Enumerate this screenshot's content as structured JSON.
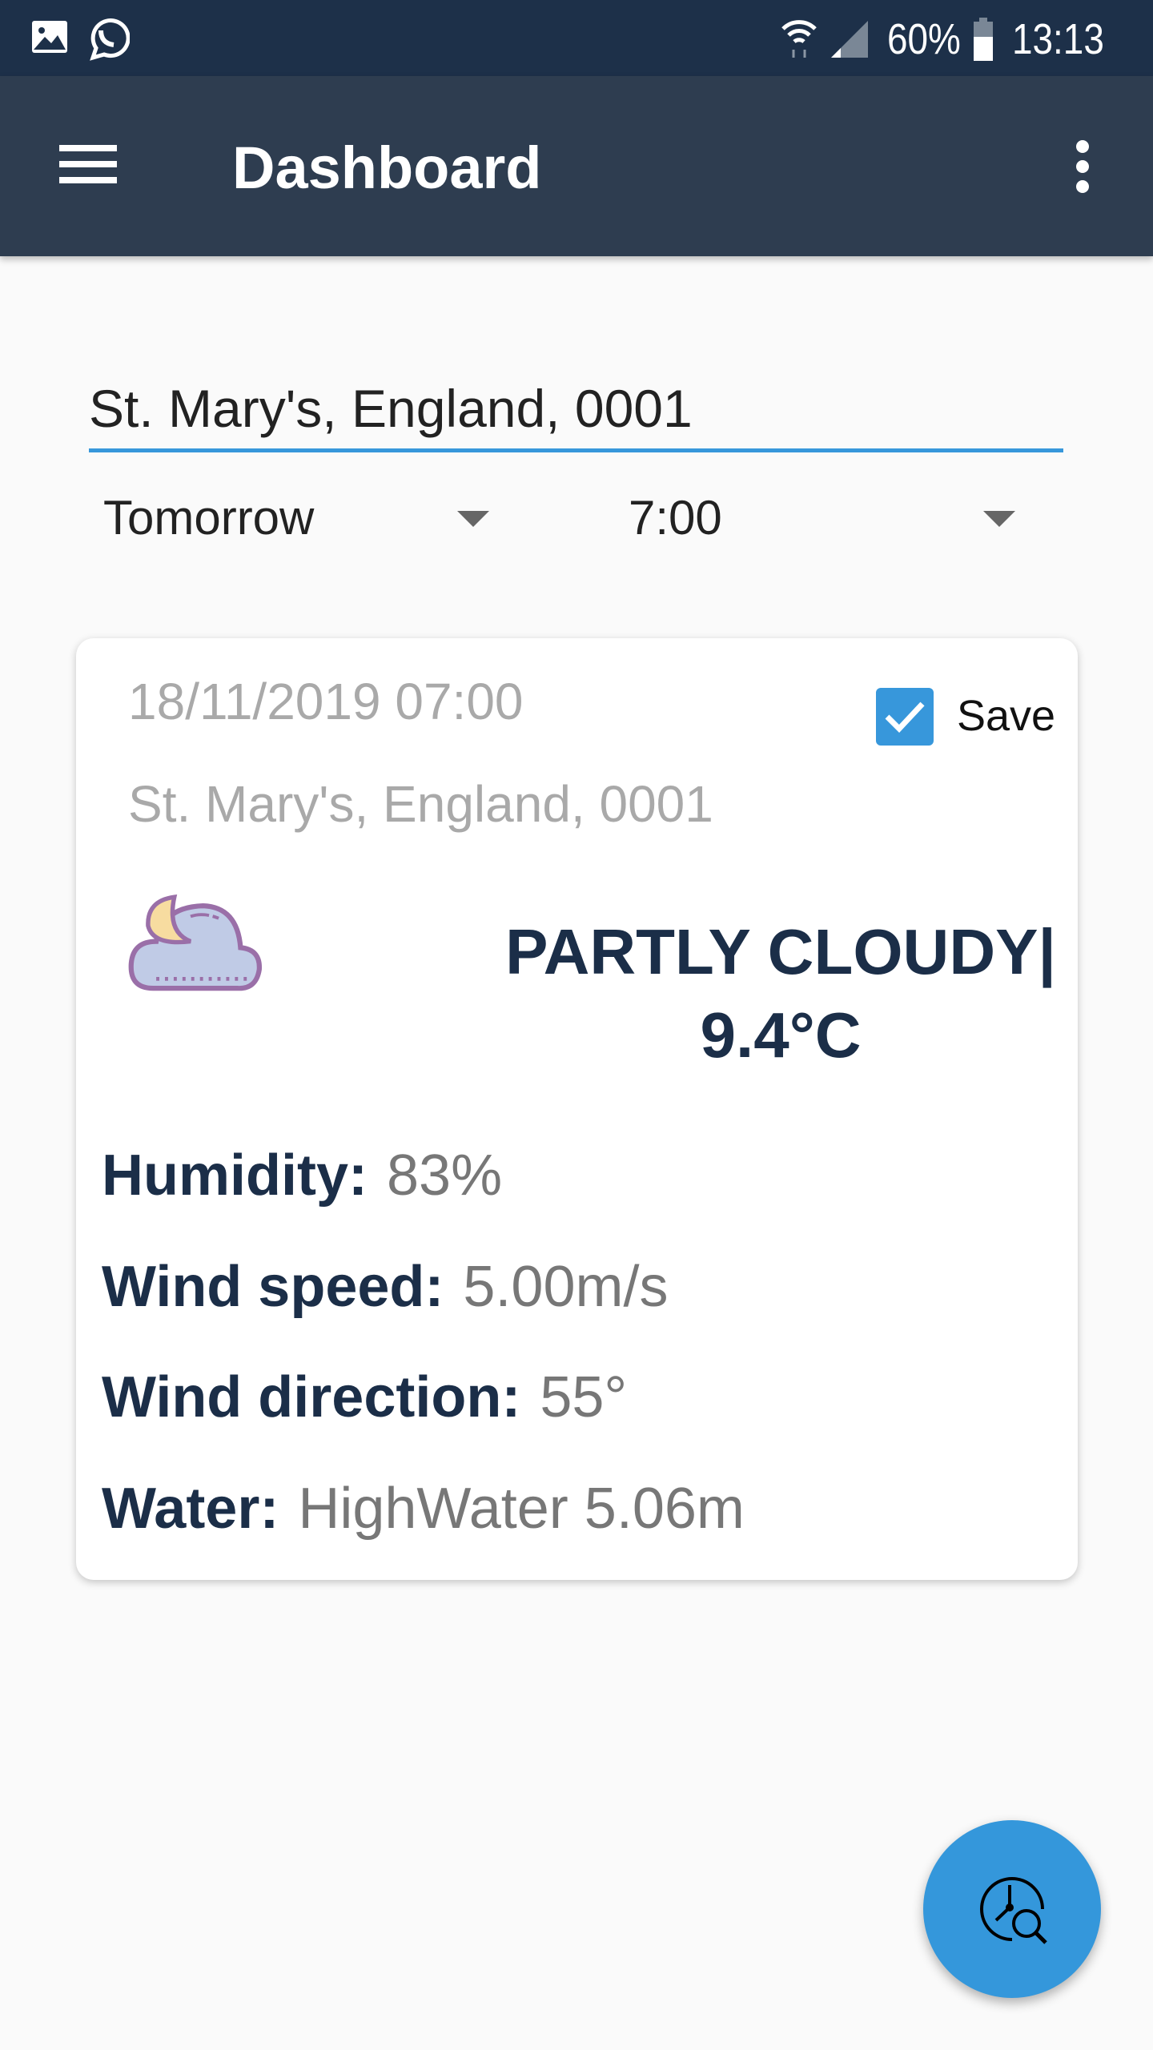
{
  "status_bar": {
    "battery": "60%",
    "time": "13:13",
    "icons": [
      "gallery-icon",
      "whatsapp-icon",
      "wifi-icon",
      "signal-icon",
      "battery-icon"
    ]
  },
  "app_bar": {
    "title": "Dashboard",
    "menu_icon": "hamburger-icon",
    "overflow_icon": "more-vert-icon"
  },
  "search": {
    "location_value": "St. Mary's, England, 0001"
  },
  "filters": {
    "day": "Tomorrow",
    "time": "7:00"
  },
  "card": {
    "datetime": "18/11/2019 07:00",
    "location": "St. Mary's, England, 0001",
    "save_label": "Save",
    "save_checked": true,
    "weather_icon": "partly-cloudy-night-icon",
    "condition": "PARTLY CLOUDY|",
    "temperature": "9.4°C",
    "details": [
      {
        "label": "Humidity:",
        "value": "83%"
      },
      {
        "label": "Wind speed:",
        "value": "5.00m/s"
      },
      {
        "label": "Wind direction:",
        "value": "55°"
      },
      {
        "label": "Water:",
        "value": "HighWater 5.06m"
      }
    ]
  },
  "fab": {
    "icon": "clock-search-icon"
  },
  "colors": {
    "status_bar": "#1d3049",
    "app_bar": "#2e3d50",
    "accent": "#3797db",
    "text_dark": "#1b2e48"
  }
}
